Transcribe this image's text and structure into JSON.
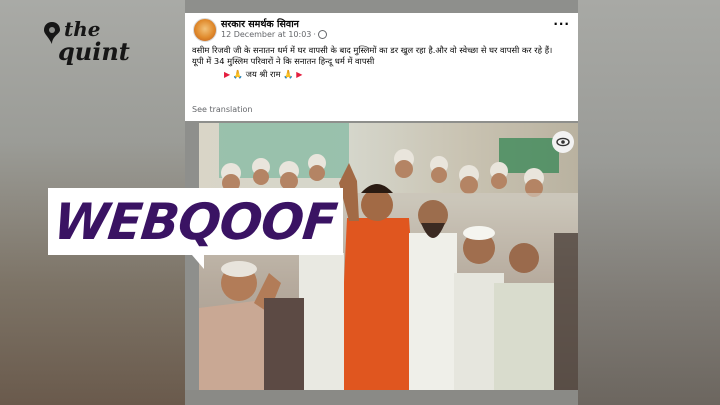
{
  "brand": {
    "logo_top": "the",
    "logo_bottom": "quint"
  },
  "post": {
    "page_name": "सरकार समर्थक सिवान",
    "timestamp": "12 December at 10:03",
    "more_label": "···",
    "line1": "वसीम रिजवी जी के सनातन धर्म में घर वापसी के बाद मुस्लिमों का डर खुल रहा है.और वो स्वेच्छा से घर वापसी कर रहे हैं।",
    "line2": "यूपी में 34 मुस्लिम परिवारों ने कि सनातन हिन्दू धर्म में वापसी",
    "line3": "जय श्री राम",
    "see_translation": "See translation"
  },
  "banner": {
    "text": "WEBQOOF"
  },
  "icons": {
    "logo_pin": "quint-pin-icon",
    "globe": "globe-icon",
    "eye": "eye-icon",
    "flag": "flag-icon"
  },
  "colors": {
    "banner_text": "#3a1363",
    "banner_bg": "#ffffff",
    "fb_text": "#050505",
    "fb_meta": "#65676b"
  }
}
